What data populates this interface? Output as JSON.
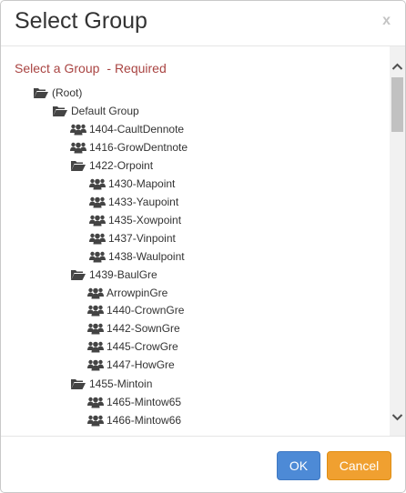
{
  "dialog": {
    "title": "Select Group",
    "close_label": "x",
    "prompt": "Select a Group",
    "required_label": "- Required"
  },
  "tree": {
    "root": {
      "label": "(Root)",
      "icon": "folder-open-icon"
    },
    "default_group": {
      "label": "Default Group",
      "icon": "folder-open-icon"
    },
    "g1404": {
      "label": "1404-CaultDennote",
      "icon": "users-icon"
    },
    "g1416": {
      "label": "1416-GrowDentnote",
      "icon": "users-icon"
    },
    "g1422": {
      "label": "1422-Orpoint",
      "icon": "folder-open-icon"
    },
    "g1430": {
      "label": "1430-Mapoint",
      "icon": "users-icon"
    },
    "g1433": {
      "label": "1433-Yaupoint",
      "icon": "users-icon"
    },
    "g1435": {
      "label": "1435-Xowpoint",
      "icon": "users-icon"
    },
    "g1437": {
      "label": "1437-Vinpoint",
      "icon": "users-icon"
    },
    "g1438": {
      "label": "1438-Waulpoint",
      "icon": "users-icon"
    },
    "g1439": {
      "label": "1439-BaulGre",
      "icon": "folder-open-icon"
    },
    "arrowpin": {
      "label": "ArrowpinGre",
      "icon": "users-icon"
    },
    "g1440": {
      "label": "1440-CrownGre",
      "icon": "users-icon"
    },
    "g1442": {
      "label": "1442-SownGre",
      "icon": "users-icon"
    },
    "g1445": {
      "label": "1445-CrowGre",
      "icon": "users-icon"
    },
    "g1447": {
      "label": "1447-HowGre",
      "icon": "users-icon"
    },
    "g1455": {
      "label": "1455-Mintoin",
      "icon": "folder-open-icon"
    },
    "g1465": {
      "label": "1465-Mintow65",
      "icon": "users-icon"
    },
    "g1466": {
      "label": "1466-Mintow66",
      "icon": "users-icon"
    }
  },
  "footer": {
    "ok_label": "OK",
    "cancel_label": "Cancel"
  },
  "colors": {
    "required_text": "#a94442",
    "ok_button": "#4d8ad6",
    "cancel_button": "#f0a030"
  }
}
